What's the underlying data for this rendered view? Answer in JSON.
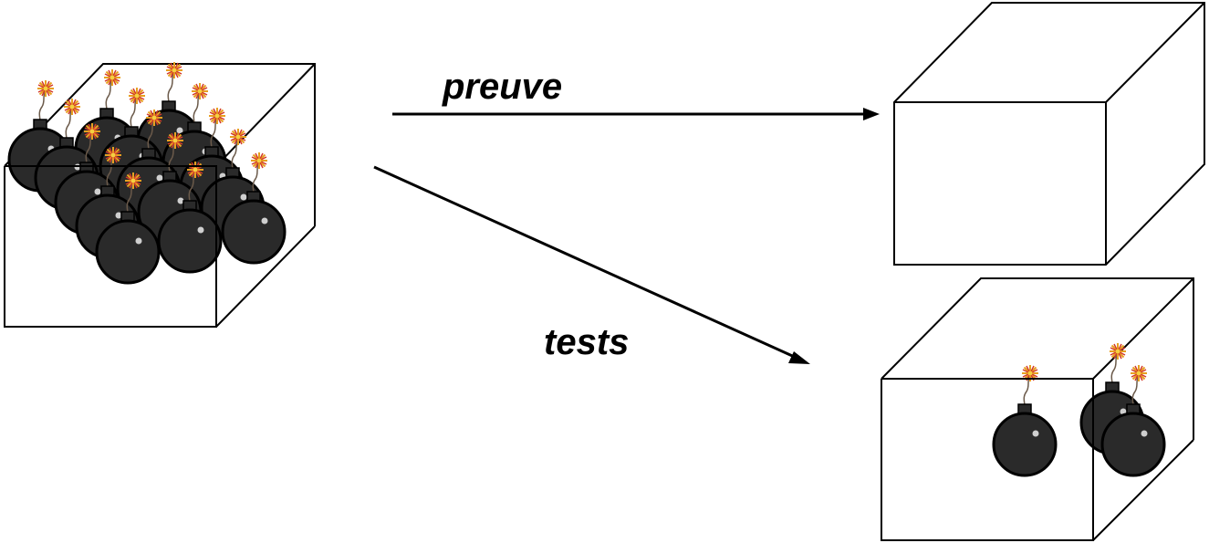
{
  "labels": {
    "proof": "preuve",
    "tests": "tests"
  },
  "boxes": {
    "source": {
      "bomb_count": 15
    },
    "proof_result": {
      "bomb_count": 0
    },
    "tests_result": {
      "bomb_count": 3
    }
  },
  "icons": {
    "bomb": "bomb-icon",
    "box": "box-icon",
    "arrow": "arrow-icon"
  },
  "colors": {
    "bomb_body": "#2a2a2a",
    "bomb_outline": "#000000",
    "spark_outer": "#e8a020",
    "spark_inner": "#d23a2a",
    "line": "#000000",
    "background": "#ffffff"
  }
}
